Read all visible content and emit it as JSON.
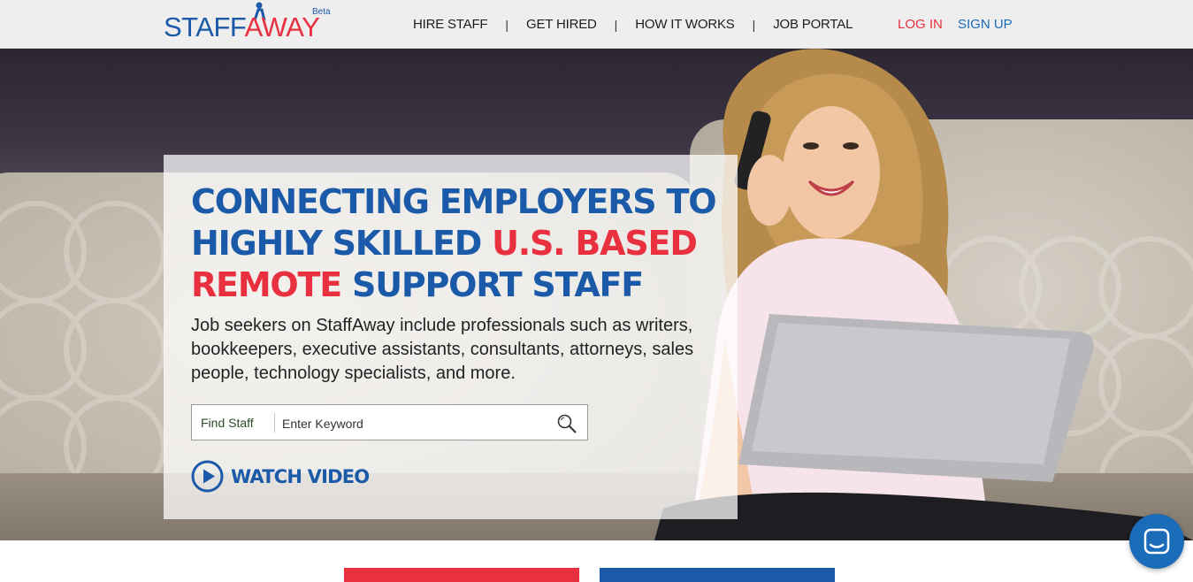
{
  "header": {
    "logo": {
      "part1": "STAFF",
      "part2": "AWAY",
      "badge": "Beta"
    },
    "nav": [
      {
        "label": "HIRE STAFF"
      },
      {
        "label": "GET HIRED"
      },
      {
        "label": "HOW IT WORKS"
      },
      {
        "label": "JOB PORTAL"
      }
    ],
    "separator": "|",
    "login_label": "LOG IN",
    "signup_label": "SIGN UP"
  },
  "hero": {
    "headline": {
      "part1": "CONNECTING EMPLOYERS TO HIGHLY SKILLED ",
      "part2": "U.S. BASED REMOTE",
      "part3": " SUPPORT STAFF"
    },
    "subtext": "Job seekers on StaffAway include professionals such as writers, bookkeepers, executive assistants, consultants, attorneys, sales people, technology specialists, and more.",
    "search": {
      "label": "Find Staff",
      "placeholder": "Enter Keyword",
      "value": ""
    },
    "watch_video_label": "WATCH VIDEO"
  },
  "colors": {
    "brand_blue": "#1a5aa8",
    "brand_red": "#e8303f",
    "chat_blue": "#1a6bb8"
  },
  "icons": {
    "search": "magnifier-icon",
    "play": "play-circle-icon",
    "chat": "chat-bubble-icon"
  }
}
